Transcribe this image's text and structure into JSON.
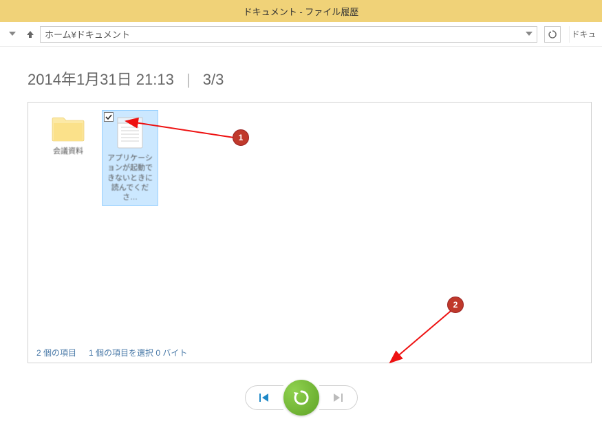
{
  "window": {
    "title": "ドキュメント - ファイル履歴"
  },
  "address": {
    "path": "ホーム¥ドキュメント",
    "right_truncated": "ドキュ"
  },
  "meta": {
    "timestamp": "2014年1月31日 21:13",
    "page": "3/3"
  },
  "items": {
    "folder": {
      "label": "会議資料"
    },
    "doc": {
      "label": "アプリケーションが起動できないときに読んでくださ…"
    }
  },
  "status": {
    "count": "2 個の項目",
    "selection": "1 個の項目を選択 0 バイト"
  },
  "annotations": {
    "a1": "1",
    "a2": "2"
  }
}
